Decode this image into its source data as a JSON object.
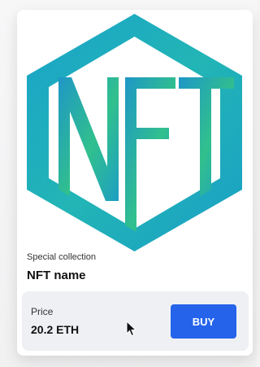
{
  "card": {
    "artwork_icon": "nft-logo-hexagon",
    "collection_label": "Special collection",
    "name": "NFT name",
    "price_label": "Price",
    "price_value": "20.2 ETH",
    "buy_label": "BUY"
  },
  "colors": {
    "accent": "#2563eb",
    "logo_teal": "#1ea7c5",
    "logo_green": "#2fbf8a"
  }
}
